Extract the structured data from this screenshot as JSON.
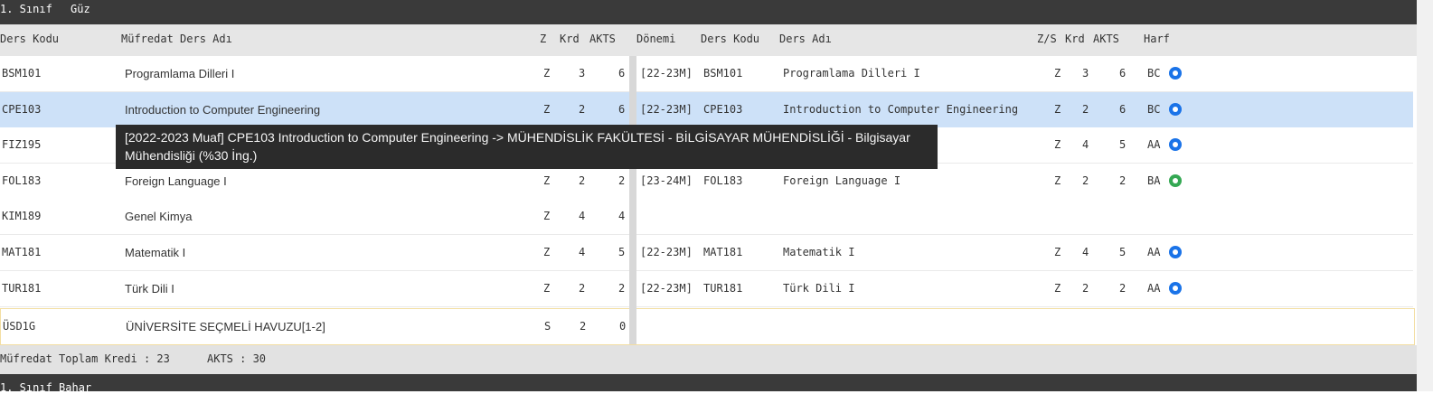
{
  "semester": {
    "class": "1. Sınıf",
    "term": "Güz"
  },
  "headers": {
    "code": "Ders Kodu",
    "name": "Müfredat Ders Adı",
    "z": "Z",
    "krd": "Krd",
    "akts": "AKTS",
    "donemi": "Dönemi",
    "code2": "Ders Kodu",
    "name2": "Ders Adı",
    "zs": "Z/S",
    "krd2": "Krd",
    "akts2": "AKTS",
    "harf": "Harf"
  },
  "rows": [
    {
      "code": "BSM101",
      "name": "Programlama Dilleri I",
      "z": "Z",
      "krd": "3",
      "akts": "6",
      "donem": "[22-23M]",
      "code2": "BSM101",
      "name2": "Programlama Dilleri I",
      "zs": "Z",
      "krd2": "3",
      "akts2": "6",
      "harf": "BC",
      "status": "blue"
    },
    {
      "code": "CPE103",
      "name": "Introduction to Computer Engineering",
      "z": "Z",
      "krd": "2",
      "akts": "6",
      "donem": "[22-23M]",
      "code2": "CPE103",
      "name2": "Introduction to Computer Engineering",
      "zs": "Z",
      "krd2": "2",
      "akts2": "6",
      "harf": "BC",
      "status": "blue"
    },
    {
      "code": "FIZ195",
      "name": "",
      "z": "",
      "krd": "",
      "akts": "",
      "donem": "",
      "code2": "",
      "name2": "",
      "zs": "Z",
      "krd2": "4",
      "akts2": "5",
      "harf": "AA",
      "status": "blue"
    },
    {
      "code": "FOL183",
      "name": "Foreign Language I",
      "z": "Z",
      "krd": "2",
      "akts": "2",
      "donem": "[23-24M]",
      "code2": "FOL183",
      "name2": "Foreign Language I",
      "zs": "Z",
      "krd2": "2",
      "akts2": "2",
      "harf": "BA",
      "status": "green"
    },
    {
      "code": "KIM189",
      "name": "Genel Kimya",
      "z": "Z",
      "krd": "4",
      "akts": "4",
      "donem": "",
      "code2": "",
      "name2": "",
      "zs": "",
      "krd2": "",
      "akts2": "",
      "harf": "",
      "status": ""
    },
    {
      "code": "MAT181",
      "name": "Matematik I",
      "z": "Z",
      "krd": "4",
      "akts": "5",
      "donem": "[22-23M]",
      "code2": "MAT181",
      "name2": "Matematik I",
      "zs": "Z",
      "krd2": "4",
      "akts2": "5",
      "harf": "AA",
      "status": "blue"
    },
    {
      "code": "TUR181",
      "name": "Türk Dili I",
      "z": "Z",
      "krd": "2",
      "akts": "2",
      "donem": "[22-23M]",
      "code2": "TUR181",
      "name2": "Türk Dili I",
      "zs": "Z",
      "krd2": "2",
      "akts2": "2",
      "harf": "AA",
      "status": "blue"
    },
    {
      "code": "ÜSD1G",
      "name": "ÜNİVERSİTE SEÇMELİ HAVUZU[1-2]",
      "z": "S",
      "krd": "2",
      "akts": "0",
      "donem": "",
      "code2": "",
      "name2": "",
      "zs": "",
      "krd2": "",
      "akts2": "",
      "harf": "",
      "status": ""
    }
  ],
  "tooltip": {
    "text": "[2022-2023 Muaf] CPE103 Introduction to Computer Engineering -> MÜHENDİSLİK FAKÜLTESİ - BİLGİSAYAR MÜHENDİSLİĞİ - Bilgisayar Mühendisliği (%30 İng.)"
  },
  "footer": {
    "total_label": "Müfredat Toplam Kredi : 23",
    "akts_label": "AKTS : 30"
  },
  "next": {
    "label": "1. Sınıf Bahar"
  },
  "colors": {
    "blue": "#1a73e8",
    "green": "#34a853",
    "selected": "#cde1f8"
  }
}
